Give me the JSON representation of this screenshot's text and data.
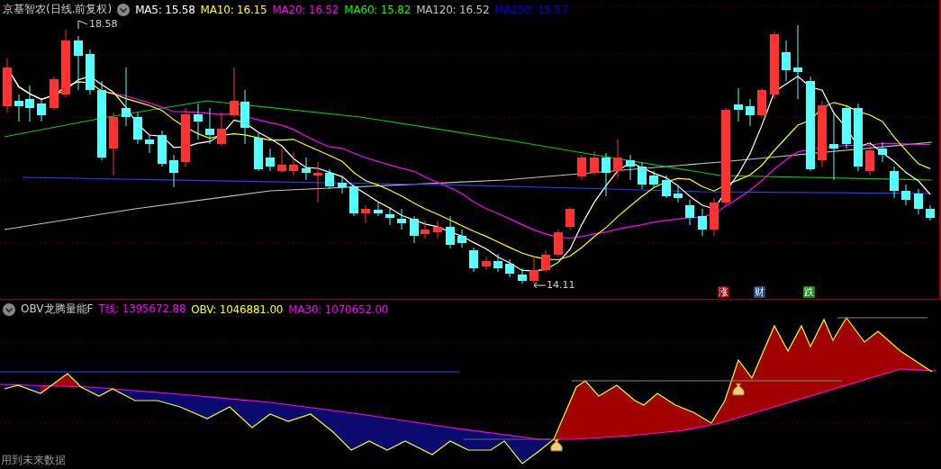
{
  "main_panel": {
    "title": "京基智农(日线.前复权)",
    "indicators": [
      {
        "label": "MA5: 15.58",
        "color": "#ffffff"
      },
      {
        "label": "MA10: 16.15",
        "color": "#ffff00"
      },
      {
        "label": "MA20: 16.52",
        "color": "#ff00ff"
      },
      {
        "label": "MA60: 15.82",
        "color": "#00ff00"
      },
      {
        "label": "MA120: 16.52",
        "color": "#c0c0c0"
      },
      {
        "label": "MA250: 15.57",
        "color": "#0000ff"
      }
    ],
    "price_markers": [
      {
        "label": "18.58",
        "kind": "high"
      },
      {
        "label": "14.11",
        "kind": "low"
      }
    ],
    "event_badges": [
      {
        "label": "涨",
        "color": "#8b0000"
      },
      {
        "label": "财",
        "color": "#1a4a7a"
      },
      {
        "label": "跌",
        "color": "#138a13"
      }
    ]
  },
  "sub_panel": {
    "title": "OBV龙腾量能F",
    "indicators": [
      {
        "label": "T线: 1395672.88",
        "color": "#ff00ff"
      },
      {
        "label": "OBV: 1046881.00",
        "color": "#ffff00"
      },
      {
        "label": "MA30: 1070652.00",
        "color": "#ff00ff"
      }
    ]
  },
  "footer": "用到未来数据"
}
